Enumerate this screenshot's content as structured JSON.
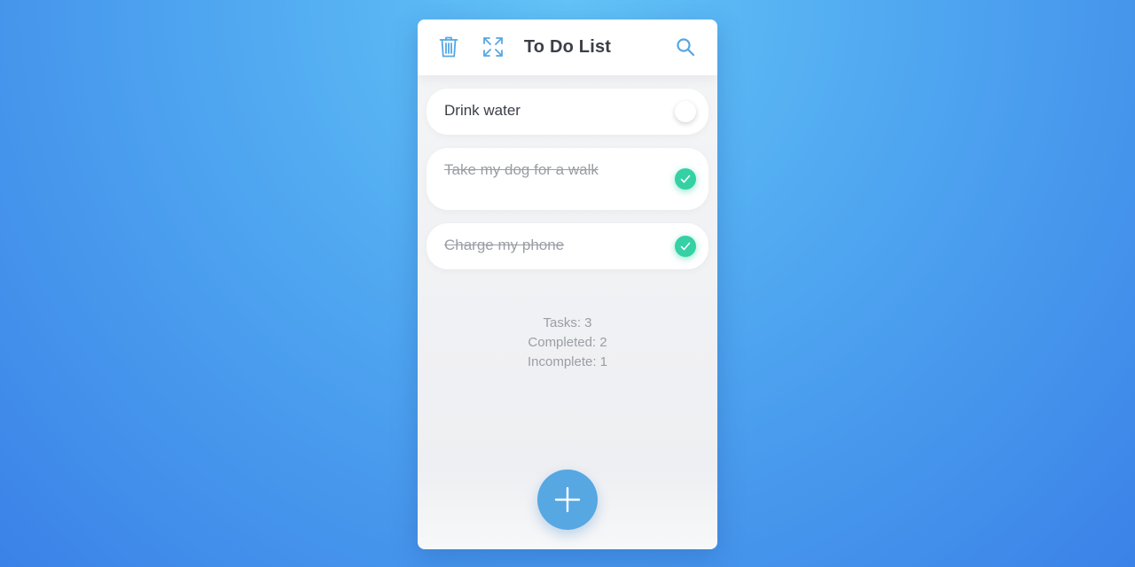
{
  "header": {
    "title": "To Do List",
    "icons": {
      "delete": "trash-icon",
      "fullscreen": "expand-icon",
      "search": "search-icon"
    },
    "icon_color": "#56a7e2"
  },
  "tasks": [
    {
      "text": "Drink water",
      "completed": false
    },
    {
      "text": "Take my dog for a walk",
      "completed": true
    },
    {
      "text": "Charge my phone",
      "completed": true
    }
  ],
  "stats": {
    "tasks": "Tasks: 3",
    "completed": "Completed: 2",
    "incomplete": "Incomplete: 1"
  },
  "add_button": {
    "icon": "plus-icon",
    "color": "#56a7e2"
  },
  "colors": {
    "check_done": "#35d0a4",
    "background_gradient": [
      "#63c4f7",
      "#3b82e8"
    ]
  }
}
